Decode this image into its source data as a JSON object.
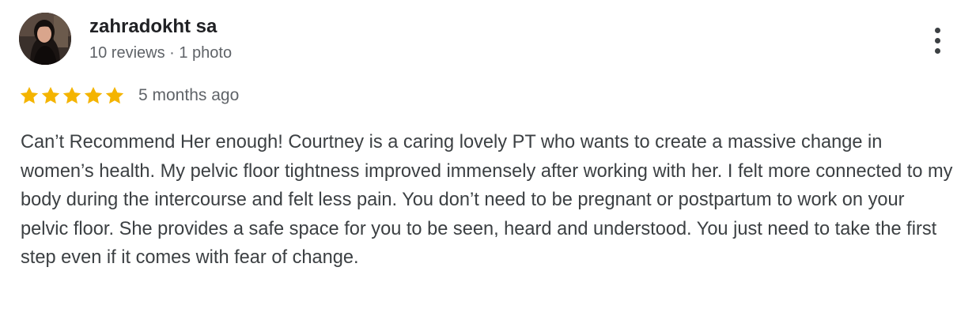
{
  "reviewer": {
    "name": "zahradokht sa",
    "meta": "10 reviews · 1 photo",
    "avatar_icon": "user-photo-avatar"
  },
  "menu": {
    "icon": "more-vertical-icon"
  },
  "rating": {
    "stars": 5,
    "max_stars": 5,
    "star_color": "#F4B400",
    "date": "5 months ago"
  },
  "review": {
    "text": "Can’t Recommend Her enough! Courtney is a caring lovely PT who wants to create a massive change in women’s health. My pelvic floor tightness improved immensely after working with her. I felt more connected to my body during the intercourse and felt less pain. You don’t need to be pregnant or postpartum to work on your pelvic floor. She provides a safe space for you to be seen, heard and understood. You just need to take the first step even if it comes with fear of change."
  }
}
